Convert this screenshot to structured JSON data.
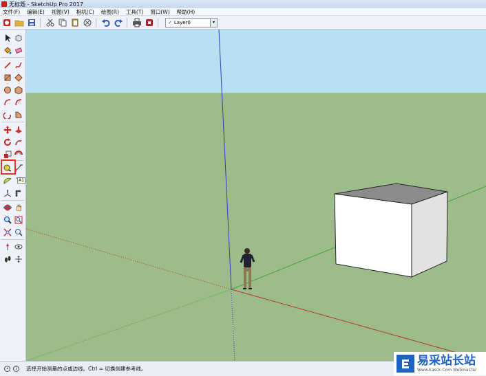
{
  "window": {
    "title": "无标题 - SketchUp Pro 2017"
  },
  "menu": [
    "文件(F)",
    "编辑(E)",
    "视图(V)",
    "相机(C)",
    "绘图(R)",
    "工具(T)",
    "窗口(W)",
    "帮助(H)"
  ],
  "toolbar": {
    "layer": {
      "check": "✓",
      "value": "Layer0",
      "arrow": "▾"
    },
    "icons": [
      "select-icon",
      "open-icon",
      "save-icon",
      "cut-icon",
      "copy-icon",
      "erase-icon",
      "undo-icon",
      "redo-icon",
      "print-icon",
      "model-info-icon"
    ]
  },
  "left_toolbar": {
    "tooltip": "A1",
    "highlighted_tool": "tape-measure-icon"
  },
  "status": {
    "text": "选择开始测量的点或边线。Ctrl = 切换创建参考线。",
    "info_icon": "i"
  },
  "watermark": {
    "text": "易采站长站",
    "url": "Www.Easck.Com WebmasTer"
  },
  "colors": {
    "sky": "#b8e0f3",
    "ground": "#9ebc8a",
    "box_front": "#ffffff",
    "box_side": "#e2e2e2",
    "box_top": "#8c8c8c",
    "axis_blue": "#2b3dbf",
    "axis_red": "#b23a2f",
    "axis_green": "#3aa537",
    "highlight": "#e0342c"
  }
}
